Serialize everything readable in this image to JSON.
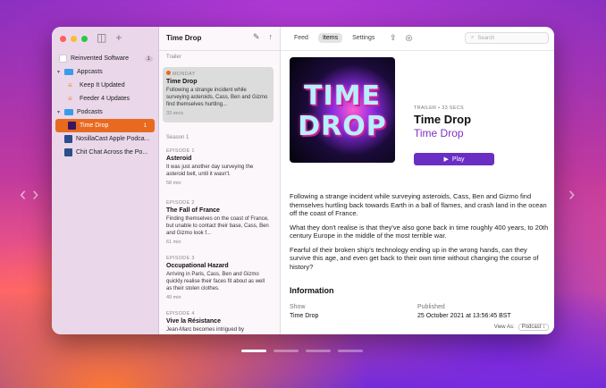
{
  "sidebar": {
    "items": [
      {
        "label": "Reinvented Software",
        "badge": "1"
      },
      {
        "label": "Appcasts"
      },
      {
        "label": "Keep It Updated"
      },
      {
        "label": "Feeder 4 Updates"
      },
      {
        "label": "Podcasts"
      },
      {
        "label": "Time Drop",
        "badge": "1"
      },
      {
        "label": "NosillaCast Apple Podca..."
      },
      {
        "label": "Chit Chat Across the Po..."
      }
    ]
  },
  "list": {
    "title": "Time Drop",
    "section_trailer": "Trailer",
    "section_season": "Season 1",
    "episodes": [
      {
        "label": "MONDAY",
        "title": "Time Drop",
        "desc": "Following a strange incident while surveying asteroids, Cass, Ben and Gizmo find themselves hurtling...",
        "dur": "33 secs"
      },
      {
        "label": "EPISODE 1",
        "title": "Asteroid",
        "desc": "It was just another day surveying the asteroid belt, until it wasn't.",
        "dur": "58 min"
      },
      {
        "label": "EPISODE 2",
        "title": "The Fall of France",
        "desc": "Finding themselves on the coast of France, but unable to contact their base, Cass, Ben and Gizmo look f...",
        "dur": "61 min"
      },
      {
        "label": "EPISODE 3",
        "title": "Occupational Hazard",
        "desc": "Arriving in Paris, Cass, Ben and Gizmo quickly realise their faces fit about as well as their stolen clothes.",
        "dur": "49 min"
      },
      {
        "label": "EPISODE 4",
        "title": "Vive la Résistance",
        "desc": "Jean-Marc becomes intrigued by"
      }
    ]
  },
  "detail": {
    "tabs": [
      "Feed",
      "Items",
      "Settings"
    ],
    "search_placeholder": "Search",
    "art_line1": "TIME",
    "art_line2": "DROP",
    "meta_small": "TRAILER • 33 SECS",
    "title": "Time Drop",
    "subtitle": "Time Drop",
    "play_label": "Play",
    "paragraphs": [
      "Following a strange incident while surveying asteroids, Cass, Ben and Gizmo find themselves hurtling back towards Earth in a ball of flames, and crash land in the ocean off the coast of France.",
      "What they don't realise is that they've also gone back in time roughly 400 years, to 20th century Europe in the middle of the most terrible war.",
      "Fearful of their broken ship's technology ending up in the wrong hands, can they survive this age, and even get back to their own time without changing the course of history?"
    ],
    "info_heading": "Information",
    "info_show_label": "Show",
    "info_published_label": "Published",
    "info_show_value": "Time Drop",
    "info_published_value": "25 October 2021 at 13:56:45 BST",
    "view_as_label": "View As:",
    "view_as_value": "Podcast"
  },
  "colors": {
    "accent": "#e86a20",
    "brand": "#7f30c4",
    "play": "#6a2ec4"
  }
}
